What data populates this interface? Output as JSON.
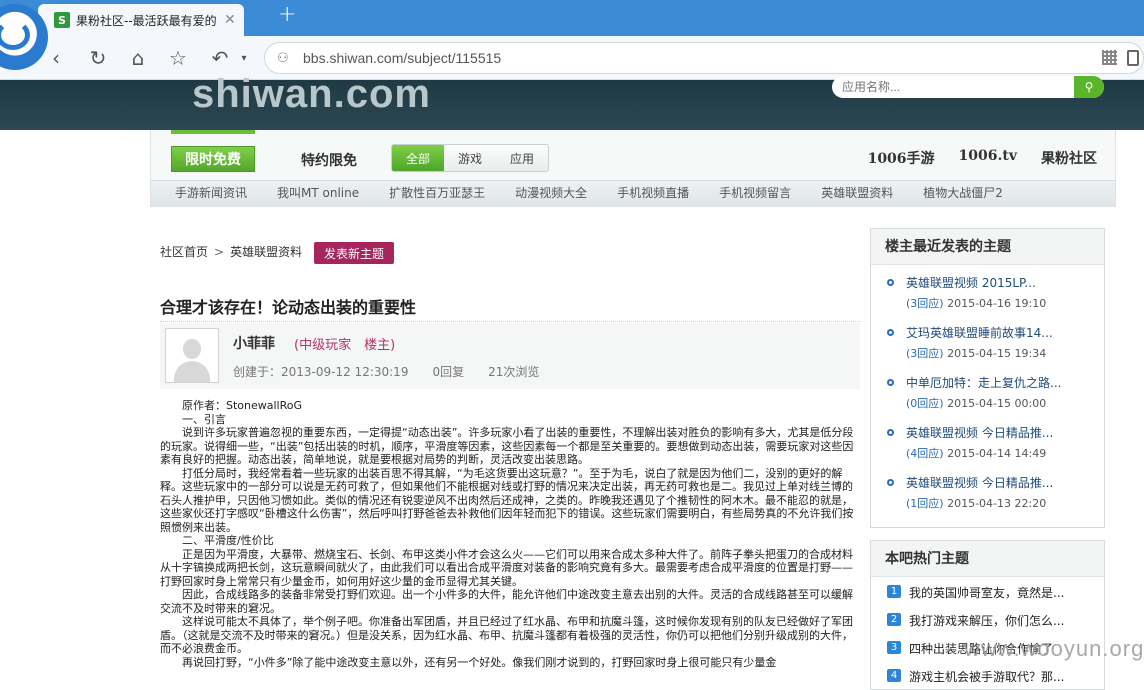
{
  "browser": {
    "tab_title": "果粉社区--最活跃最有爱的",
    "tab_favicon": "S",
    "tab_close": "✕",
    "new_tab": "+",
    "url": "bbs.shiwan.com/subject/115515"
  },
  "site": {
    "logo_text": "shiwan.com",
    "search_placeholder": "应用名称...",
    "search_icon": "search-icon"
  },
  "top_nav": {
    "free_label": "限时免费",
    "special_label": "特约限免",
    "segments": [
      {
        "label": "全部",
        "active": true
      },
      {
        "label": "游戏",
        "active": false
      },
      {
        "label": "应用",
        "active": false
      }
    ],
    "right_links": [
      "1006手游",
      "1006.tv",
      "果粉社区"
    ],
    "sub_items": [
      "手游新闻资讯",
      "我叫MT online",
      "扩散性百万亚瑟王",
      "动漫视频大全",
      "手机视频直播",
      "手机视频留言",
      "英雄联盟资料",
      "植物大战僵尸2"
    ]
  },
  "breadcrumb": {
    "home": "社区首页",
    "sep": ">",
    "section": "英雄联盟资料",
    "post_button": "发表新主题"
  },
  "post": {
    "title": "合理才该存在！论动态出装的重要性",
    "author": "小菲菲",
    "rank": "(中级玩家　楼主)",
    "created": "创建于：2013-09-12 12:30:19",
    "replies": "0回复",
    "views": "21次浏览",
    "paragraphs": [
      "原作者：StonewallRoG",
      "一、引言",
      "说到许多玩家普遍忽视的重要东西，一定得提“动态出装”。许多玩家小看了出装的重要性，不理解出装对胜负的影响有多大，尤其是低分段的玩家。说得细一些，“出装”包括出装的时机，顺序，平滑度等因素，这些因素每一个都是至关重要的。要想做到动态出装，需要玩家对这些因素有良好的把握。动态出装，简单地说，就是要根据对局势的判断，灵活改变出装思路。",
      "打低分局时，我经常看着一些玩家的出装百思不得其解，“为毛这货要出这玩意？”。至于为毛，说白了就是因为他们二，没别的更好的解释。这些玩家中的一部分可以说是无药可救了，但如果他们不能根据对线或打野的情况来决定出装，再无药可救也是二。我见过上单对线兰博的石头人推护甲，只因他习惯如此。类似的情况还有锐雯逆风不出肉然后还成神，之类的。昨晚我还遇见了个推韧性的阿木木。最不能忍的就是，这些家伙还打字感叹“卧槽这什么伤害”，然后呼叫打野爸爸去补救他们因年轻而犯下的错误。这些玩家们需要明白，有些局势真的不允许我们按照惯例来出装。",
      "二、平滑度/性价比",
      "正是因为平滑度，大暴带、燃烧宝石、长剑、布甲这类小件才会这么火——它们可以用来合成太多种大件了。前阵子拳头把蛋刀的合成材料从十字镐换成两把长剑，这玩意瞬间就火了，由此我们可以看出合成平滑度对装备的影响究竟有多大。最需要考虑合成平滑度的位置是打野——打野回家时身上常常只有少量金币，如何用好这少量的金币显得尤其关键。",
      "因此，合成线路多的装备非常受打野们欢迎。出一个小件多的大件，能允许他们中途改变主意去出别的大件。灵活的合成线路甚至可以缓解交流不及时带来的窘况。",
      "这样说可能太不具体了，举个例子吧。你准备出军团盾，并且已经过了红水晶、布甲和抗魔斗篷，这时候你发现有别的队友已经做好了军团盾。（这就是交流不及时带来的窘况。）但是没关系，因为红水晶、布甲、抗魔斗篷都有着极强的灵活性，你仍可以把他们分别升级成别的大件，而不必浪费金币。",
      "再说回打野，“小件多”除了能中途改变主意以外，还有另一个好处。像我们刚才说到的，打野回家时身上很可能只有少量金"
    ]
  },
  "sidebar": {
    "recent_title": "楼主最近发表的主题",
    "recent": [
      {
        "title": "英雄联盟视频 2015LP...",
        "replies": "(3回应)",
        "time": "2015-04-16 19:10"
      },
      {
        "title": "艾玛英雄联盟睡前故事14...",
        "replies": "(3回应)",
        "time": "2015-04-15 19:34"
      },
      {
        "title": "中单厄加特：走上复仇之路...",
        "replies": "(0回应)",
        "time": "2015-04-15 00:00"
      },
      {
        "title": "英雄联盟视频 今日精品推...",
        "replies": "(4回应)",
        "time": "2015-04-14 14:49"
      },
      {
        "title": "英雄联盟视频 今日精品推...",
        "replies": "(1回应)",
        "time": "2015-04-13 22:20"
      }
    ],
    "hot_title": "本吧热门主题",
    "hot": [
      {
        "num": "1",
        "title": "我的英国帅哥室友，竟然是..."
      },
      {
        "num": "2",
        "title": "我打游戏来解压，你们怎么..."
      },
      {
        "num": "3",
        "title": "四种出装思路让你合作愉了"
      },
      {
        "num": "4",
        "title": "游戏主机会被手游取代？那..."
      }
    ]
  },
  "watermark": "www.wooyun.org"
}
